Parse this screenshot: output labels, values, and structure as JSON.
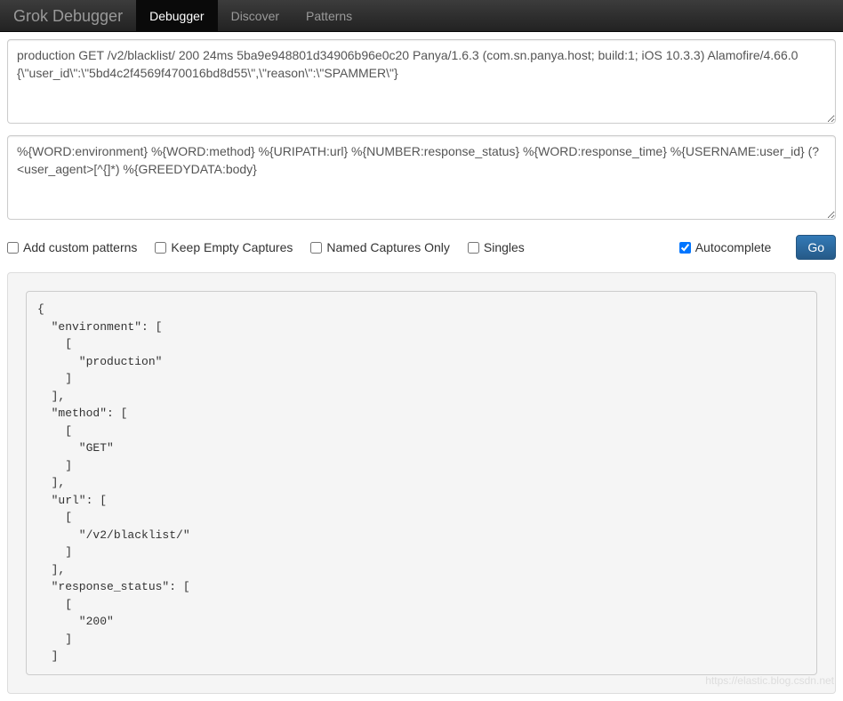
{
  "navbar": {
    "brand": "Grok Debugger",
    "items": [
      {
        "label": "Debugger",
        "active": true
      },
      {
        "label": "Discover",
        "active": false
      },
      {
        "label": "Patterns",
        "active": false
      }
    ]
  },
  "inputs": {
    "sample_text": "production GET /v2/blacklist/ 200 24ms 5ba9e948801d34906b96e0c20 Panya/1.6.3 (com.sn.panya.host; build:1; iOS 10.3.3) Alamofire/4.66.0 {\\\"user_id\\\":\\\"5bd4c2f4569f470016bd8d55\\\",\\\"reason\\\":\\\"SPAMMER\\\"}",
    "pattern_text": "%{WORD:environment} %{WORD:method} %{URIPATH:url} %{NUMBER:response_status} %{WORD:response_time} %{USERNAME:user_id} (?<user_agent>[^{]*) %{GREEDYDATA:body}"
  },
  "options": {
    "add_custom_patterns": {
      "label": "Add custom patterns",
      "checked": false
    },
    "keep_empty_captures": {
      "label": "Keep Empty Captures",
      "checked": false
    },
    "named_captures_only": {
      "label": "Named Captures Only",
      "checked": false
    },
    "singles": {
      "label": "Singles",
      "checked": false
    },
    "autocomplete": {
      "label": "Autocomplete",
      "checked": true
    }
  },
  "buttons": {
    "go": "Go"
  },
  "result_json": "{\n  \"environment\": [\n    [\n      \"production\"\n    ]\n  ],\n  \"method\": [\n    [\n      \"GET\"\n    ]\n  ],\n  \"url\": [\n    [\n      \"/v2/blacklist/\"\n    ]\n  ],\n  \"response_status\": [\n    [\n      \"200\"\n    ]\n  ]",
  "watermark": "https://elastic.blog.csdn.net"
}
